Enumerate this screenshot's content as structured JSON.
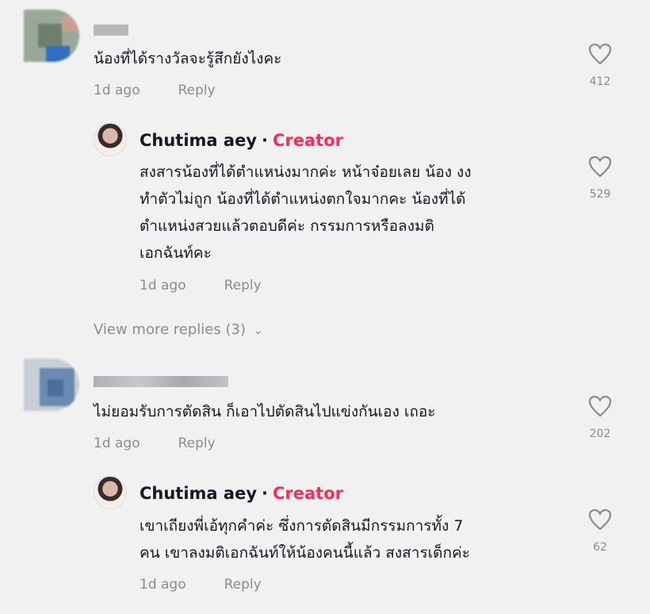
{
  "comments": [
    {
      "text": "น้องที่ได้รางวัลจะรู้สึกยังไงคะ",
      "time": "1d ago",
      "reply": "Reply",
      "likes": "412",
      "reply_item": {
        "name": "Chutima aey",
        "sep": "·",
        "badge": "Creator",
        "text": "สงสารน้องที่ได้ตำแหน่งมากค่ะ หน้าจ๋อยเลย น้อง งง\nทำตัวไม่ถูก น้องที่ได้ตำแหน่งตกใจมากคะ น้องที่ได้\nตำแหน่งสวยแล้วตอบดีค่ะ กรรมการหรือลงมติ\nเอกฉันท์คะ",
        "time": "1d ago",
        "reply": "Reply",
        "likes": "529"
      },
      "view_more": "View more replies (3)"
    },
    {
      "text": "ไม่ยอมรับการตัดสิน ก็เอาไปตัดสินไปแข่งกันเอง เถอะ",
      "time": "1d ago",
      "reply": "Reply",
      "likes": "202",
      "reply_item": {
        "name": "Chutima aey",
        "sep": "·",
        "badge": "Creator",
        "text": "เขาเถียงพี่เอ้ทุกคำค่ะ ซึ่งการตัดสินมีกรรมการทั้ง 7\nคน เขาลงมติเอกฉันท์ให้น้องคนนี้แล้ว สงสารเด็กค่ะ",
        "time": "1d ago",
        "reply": "Reply",
        "likes": "62"
      }
    }
  ],
  "colors": {
    "creator": "#fe2c55",
    "muted": "#8a8b91",
    "text": "#161823"
  }
}
